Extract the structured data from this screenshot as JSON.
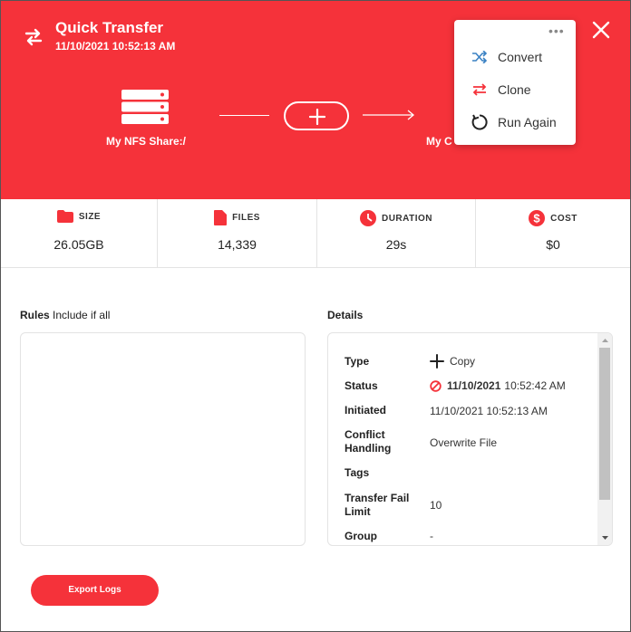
{
  "header": {
    "title": "Quick Transfer",
    "datetime": "11/10/2021 10:52:13 AM",
    "source_label": "My NFS Share:/",
    "destination_label": "My C",
    "bg_color": "#f5323a"
  },
  "menu": {
    "dots": "•••",
    "items": [
      {
        "label": "Convert",
        "icon": "shuffle-icon",
        "color": "#3b82c4"
      },
      {
        "label": "Clone",
        "icon": "swap-arrows-icon",
        "color": "#f5323a"
      },
      {
        "label": "Run Again",
        "icon": "refresh-icon",
        "color": "#222222"
      }
    ]
  },
  "stats": [
    {
      "label": "SIZE",
      "value": "26.05GB",
      "icon": "folder-icon"
    },
    {
      "label": "FILES",
      "value": "14,339",
      "icon": "file-icon"
    },
    {
      "label": "DURATION",
      "value": "29s",
      "icon": "clock-icon"
    },
    {
      "label": "COST",
      "value": "$0",
      "icon": "dollar-icon"
    }
  ],
  "rules": {
    "title": "Rules",
    "subtitle": "Include if all"
  },
  "details": {
    "title": "Details",
    "rows": [
      {
        "key": "Type",
        "value": "Copy"
      },
      {
        "key": "Status",
        "value_date": "11/10/2021",
        "value_time": "10:52:42 AM"
      },
      {
        "key": "Initiated",
        "value": "11/10/2021 10:52:13 AM"
      },
      {
        "key": "Conflict Handling",
        "value": "Overwrite File"
      },
      {
        "key": "Tags",
        "value": ""
      },
      {
        "key": "Transfer Fail Limit",
        "value": "10"
      },
      {
        "key": "Group",
        "value": "-"
      }
    ]
  },
  "actions": {
    "export_logs": "Export Logs"
  }
}
